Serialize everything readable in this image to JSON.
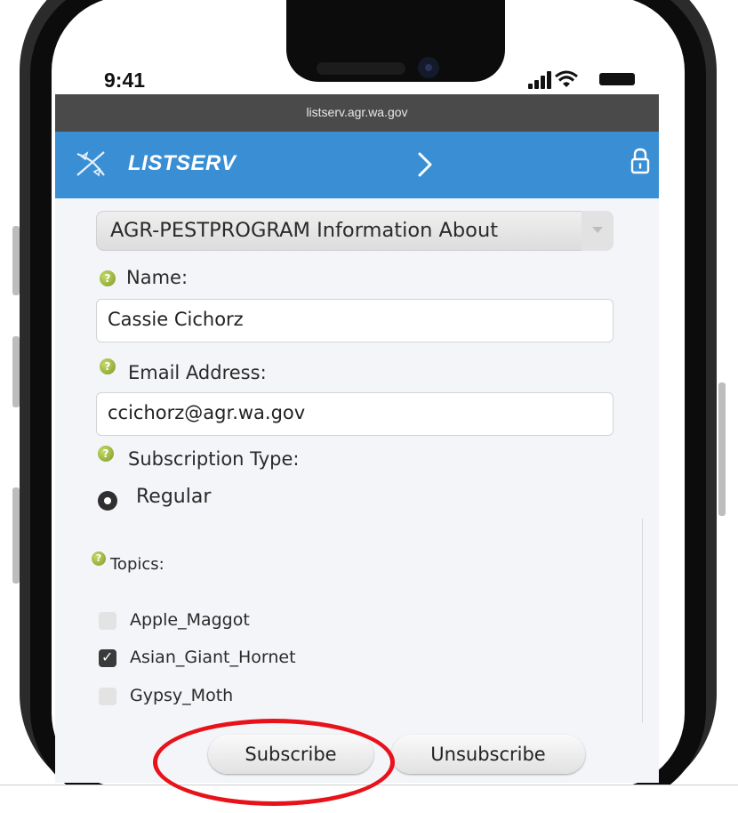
{
  "status_bar": {
    "time": "9:41"
  },
  "browser": {
    "url": "listserv.agr.wa.gov"
  },
  "header": {
    "brand": "LISTSERV"
  },
  "form": {
    "list_select": {
      "value": "AGR-PESTPROGRAM Information About"
    },
    "name": {
      "label": "Name:",
      "value": "Cassie Cichorz"
    },
    "email": {
      "label": "Email Address:",
      "value": "ccichorz@agr.wa.gov"
    },
    "subscription_type": {
      "label": "Subscription Type:",
      "option": "Regular"
    },
    "topics": {
      "label": "Topics:",
      "items": [
        {
          "label": "Apple_Maggot",
          "checked": false
        },
        {
          "label": "Asian_Giant_Hornet",
          "checked": true
        },
        {
          "label": "Gypsy_Moth",
          "checked": false
        }
      ]
    },
    "help_glyph": "?",
    "subscribe_label": "Subscribe",
    "unsubscribe_label": "Unsubscribe"
  },
  "colors": {
    "header_blue": "#3a8fd4",
    "url_bar": "#4a4a4a",
    "highlight_ring": "#e8121a"
  }
}
